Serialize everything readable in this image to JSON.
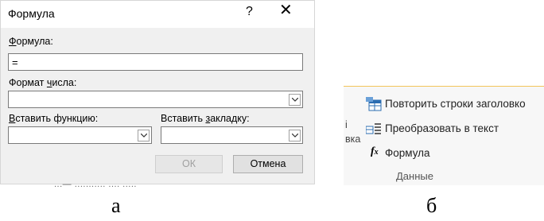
{
  "dialog": {
    "title": "Формула",
    "help": "?",
    "close": "✕",
    "formula_label_first": "Ф",
    "formula_label_rest": "ормула:",
    "formula_value": "=",
    "number_format_label_a": "Формат ",
    "number_format_label_u": "ч",
    "number_format_label_b": "исла:",
    "insert_function_label_u": "В",
    "insert_function_label_b": "ставить функцию:",
    "insert_bookmark_label_a": "Вставить ",
    "insert_bookmark_label_u": "з",
    "insert_bookmark_label_b": "акладку:",
    "ok": "ОК",
    "cancel": "Отмена",
    "background_text": "...— ...........  .... ....."
  },
  "captions": {
    "a": "а",
    "b": "б"
  },
  "ribbon": {
    "repeat_header_rows": "Повторить строки заголовко",
    "convert_to_text": "Преобразовать в текст",
    "formula": "Формула",
    "group_label": "Данные",
    "left_fragment_1": "і",
    "left_fragment_2": "вка"
  },
  "colors": {
    "ribbon_accent": "#f3c45a",
    "icon_blue": "#2b6cb0"
  }
}
